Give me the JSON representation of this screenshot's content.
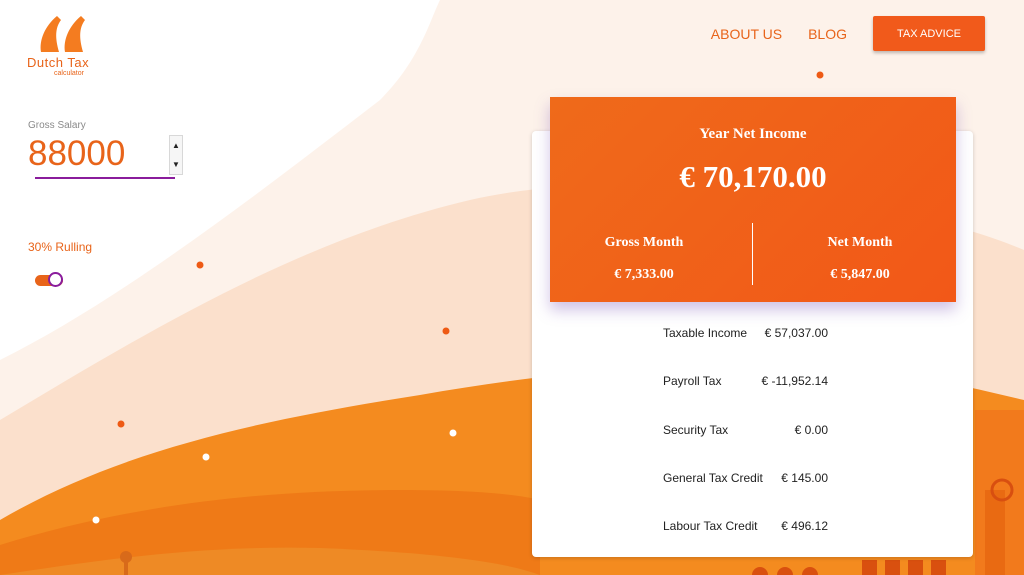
{
  "brand": {
    "name": "Dutch Tax",
    "tagline": "calculator",
    "logo_icon": "quote-marks-logo",
    "accent": "#e8641a"
  },
  "nav": {
    "about": "ABOUT US",
    "blog": "BLOG",
    "tax_advice": "TAX ADVICE"
  },
  "salary": {
    "label": "Gross Salary",
    "value": "88000"
  },
  "rulling": {
    "label": "30% Rulling",
    "enabled": true
  },
  "summary": {
    "title": "Year Net Income",
    "amount": "€ 70,170.00",
    "gross_month_label": "Gross Month",
    "gross_month_value": "€ 7,333.00",
    "net_month_label": "Net Month",
    "net_month_value": "€ 5,847.00"
  },
  "details": [
    {
      "label": "Taxable Income",
      "value": "€ 57,037.00"
    },
    {
      "label": "Payroll Tax",
      "value": "€ -11,952.14"
    },
    {
      "label": "Security Tax",
      "value": "€ 0.00"
    },
    {
      "label": "General Tax Credit",
      "value": "€ 145.00"
    },
    {
      "label": "Labour Tax Credit",
      "value": "€ 496.12"
    }
  ]
}
